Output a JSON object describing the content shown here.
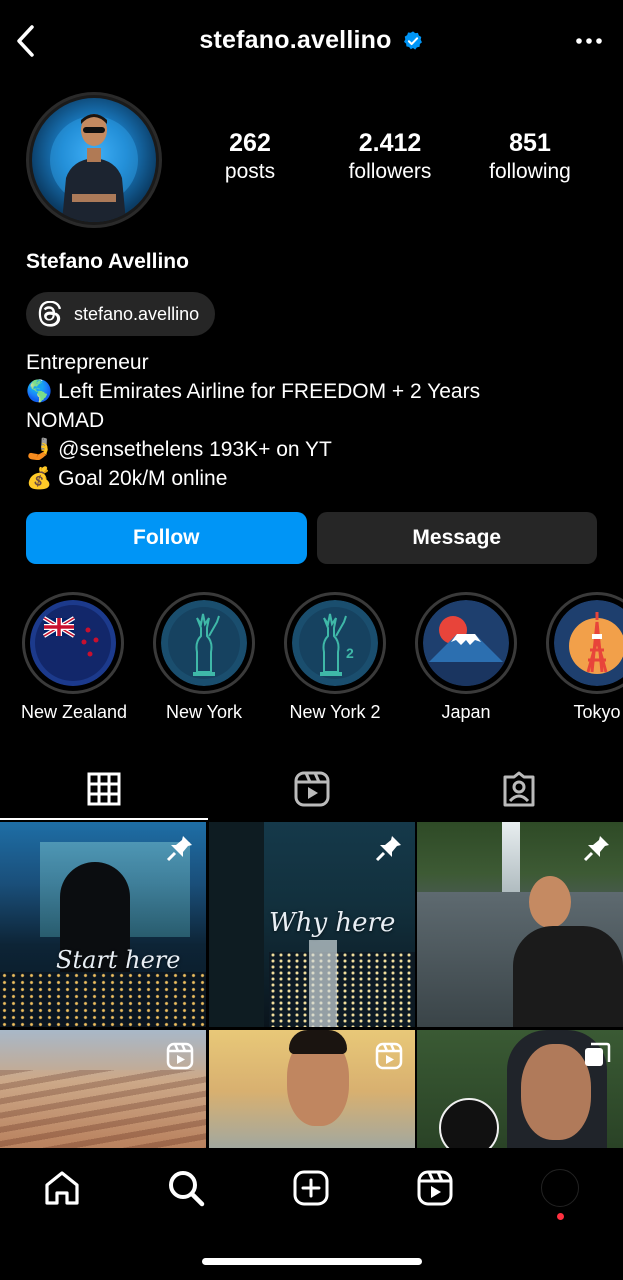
{
  "header": {
    "username": "stefano.avellino",
    "verified": true
  },
  "profile": {
    "display_name": "Stefano Avellino",
    "threads_handle": "stefano.avellino"
  },
  "stats": [
    {
      "value": "262",
      "label": "posts"
    },
    {
      "value": "2.412",
      "label": "followers"
    },
    {
      "value": "851",
      "label": "following"
    }
  ],
  "bio": {
    "line1": "Entrepreneur",
    "line2_emoji": "🌎",
    "line2": "Left Emirates Airline for FREEDOM + 2 Years",
    "line3": "NOMAD",
    "line4_emoji": "🤳",
    "line4": "@sensethelens 193K+ on YT",
    "line5_emoji": "💰",
    "line5": "Goal 20k/M online"
  },
  "actions": {
    "follow_label": "Follow",
    "message_label": "Message"
  },
  "highlights": [
    {
      "label": "New Zealand",
      "icon": "new-zealand-flag-icon"
    },
    {
      "label": "New York",
      "icon": "statue-of-liberty-icon"
    },
    {
      "label": "New York 2",
      "icon": "statue-of-liberty-2-icon"
    },
    {
      "label": "Japan",
      "icon": "mount-fuji-icon"
    },
    {
      "label": "Tokyo",
      "icon": "tokyo-tower-icon"
    }
  ],
  "tabs": [
    {
      "name": "grid-tab",
      "icon": "grid-icon",
      "active": true
    },
    {
      "name": "reels-tab",
      "icon": "reels-icon",
      "active": false
    },
    {
      "name": "tagged-tab",
      "icon": "tagged-person-icon",
      "active": false
    }
  ],
  "posts": [
    {
      "text": "Start here",
      "badge": "pin-icon"
    },
    {
      "text": "Why here",
      "badge": "pin-icon"
    },
    {
      "text": "",
      "badge": "pin-icon"
    },
    {
      "text": "",
      "badge": "reel-icon"
    },
    {
      "text": "",
      "badge": "reel-icon"
    },
    {
      "text": "",
      "badge": "carousel-icon"
    }
  ],
  "bottom_nav": [
    "home-icon",
    "search-icon",
    "create-icon",
    "reels-icon",
    "profile-icon"
  ],
  "colors": {
    "follow_button": "#0095f6",
    "secondary_button": "#262626",
    "verified_badge": "#0095f6",
    "notification_dot": "#ff3040"
  }
}
